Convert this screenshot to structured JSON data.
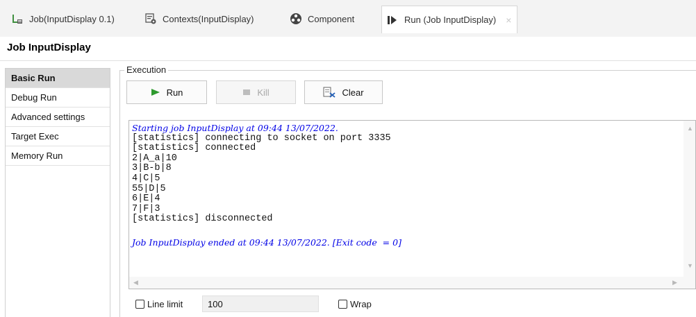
{
  "tabs": [
    {
      "label": "Job(InputDisplay 0.1)",
      "icon": "job-icon"
    },
    {
      "label": "Contexts(InputDisplay)",
      "icon": "contexts-icon"
    },
    {
      "label": "Component",
      "icon": "component-icon"
    },
    {
      "label": "Run (Job InputDisplay)",
      "icon": "run-view-icon",
      "active": true,
      "close": "×"
    }
  ],
  "title": "Job InputDisplay",
  "nav": {
    "items": [
      "Basic Run",
      "Debug Run",
      "Advanced settings",
      "Target Exec",
      "Memory Run"
    ],
    "active_index": 0
  },
  "execution": {
    "legend": "Execution",
    "run_label": "Run",
    "kill_label": "Kill",
    "clear_label": "Clear"
  },
  "console": {
    "lines": [
      {
        "text": "Starting job InputDisplay at 09:44 13/07/2022.",
        "style": "blue"
      },
      {
        "text": "[statistics] connecting to socket on port 3335",
        "style": "normal"
      },
      {
        "text": "[statistics] connected",
        "style": "normal"
      },
      {
        "text": "2|A_a|10",
        "style": "normal"
      },
      {
        "text": "3|B-b|8",
        "style": "normal"
      },
      {
        "text": "4|C|5",
        "style": "normal"
      },
      {
        "text": "55|D|5",
        "style": "normal"
      },
      {
        "text": "6|E|4",
        "style": "normal"
      },
      {
        "text": "7|F|3",
        "style": "normal"
      },
      {
        "text": "[statistics] disconnected",
        "style": "normal"
      },
      {
        "text": "",
        "style": "normal"
      },
      {
        "text": "Job InputDisplay ended at 09:44 13/07/2022. [Exit code  = 0]",
        "style": "blue"
      }
    ]
  },
  "options": {
    "line_limit_label": "Line limit",
    "line_limit_value": "100",
    "line_limit_checked": false,
    "wrap_label": "Wrap",
    "wrap_checked": false
  },
  "colors": {
    "console_blue": "#0000e6",
    "run_green": "#2e9a2e",
    "active_nav_bg": "#d9d9d9"
  }
}
